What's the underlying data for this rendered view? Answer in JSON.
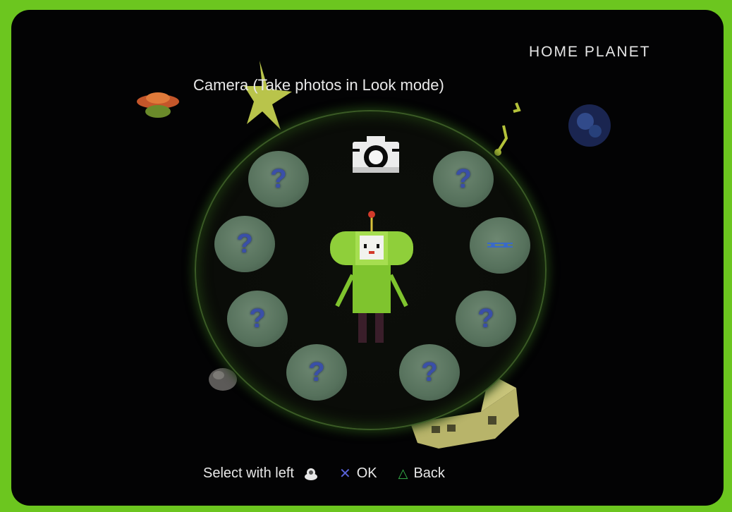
{
  "header": {
    "location": "HOME PLANET",
    "hint": "Camera (Take photos in Look mode)"
  },
  "menu": {
    "selected_item_icon": "camera-icon",
    "slots": [
      {
        "label": "?",
        "state": "locked"
      },
      {
        "label": "?",
        "state": "locked"
      },
      {
        "label": "?",
        "state": "locked"
      },
      {
        "label": "?",
        "state": "locked"
      },
      {
        "label": "?",
        "state": "locked"
      },
      {
        "label": "?",
        "state": "locked"
      },
      {
        "label": "?",
        "state": "locked"
      }
    ],
    "unlocked_slot_icon": "notes-icon"
  },
  "footer": {
    "select_label": "Select with left",
    "select_icon": "analog-stick-icon",
    "ok_label": "OK",
    "ok_icon": "cross-button-icon",
    "back_label": "Back",
    "back_icon": "triangle-button-icon"
  },
  "colors": {
    "border": "#6cc61f",
    "background": "#030304",
    "slot": "#5b745f",
    "question_mark": "#3a4fa8",
    "prince": "#8fcf3a"
  }
}
